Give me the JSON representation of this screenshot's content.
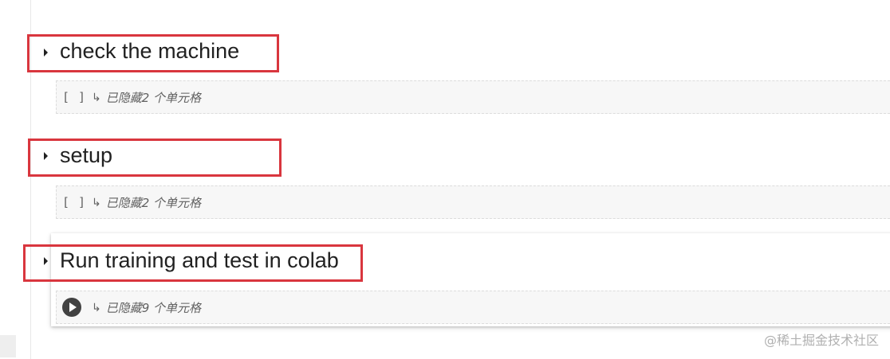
{
  "sections": [
    {
      "title": "check the machine",
      "hidden_text": "已隐藏2 个单元格",
      "cell_marker": "[ ]"
    },
    {
      "title": "setup",
      "hidden_text": "已隐藏2 个单元格",
      "cell_marker": "[ ]"
    },
    {
      "title": "Run training and test in colab",
      "hidden_text": "已隐藏9 个单元格",
      "cell_marker": ""
    }
  ],
  "icons": {
    "collapse_toggle": "triangle-right-icon",
    "hidden_cells": "return-arrow-icon",
    "run": "play-circle-icon"
  },
  "watermark": "@稀土掘金技术社区",
  "colors": {
    "highlight": "#d9363e",
    "run_button": "#424242",
    "hidden_bar": "#f7f7f7"
  }
}
